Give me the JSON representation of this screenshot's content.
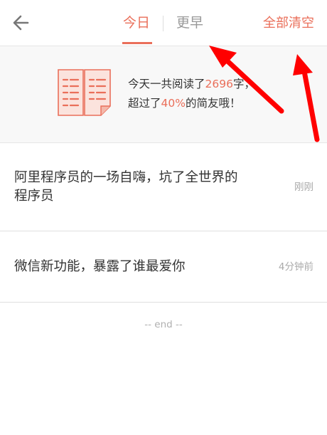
{
  "header": {
    "back_icon": "arrow-left-icon",
    "tabs": [
      {
        "label": "今日",
        "active": true
      },
      {
        "label": "更早",
        "active": false
      }
    ],
    "clear_all_label": "全部清空"
  },
  "stats": {
    "icon": "open-book-icon",
    "line1_prefix": "今天一共阅读了",
    "words_read": "2696",
    "line1_suffix": "字，",
    "line2_prefix": "超过了",
    "percent": "40%",
    "line2_suffix": "的简友哦！"
  },
  "articles": [
    {
      "title": "阿里程序员的一场自嗨，坑了全世界的程序员",
      "time": "刚刚"
    },
    {
      "title": "微信新功能，暴露了谁最爱你",
      "time": "4分钟前"
    }
  ],
  "end_marker": "-- end --",
  "colors": {
    "accent": "#ea6f5a",
    "annotation_arrow": "#ff0000",
    "muted_text": "#999999"
  }
}
